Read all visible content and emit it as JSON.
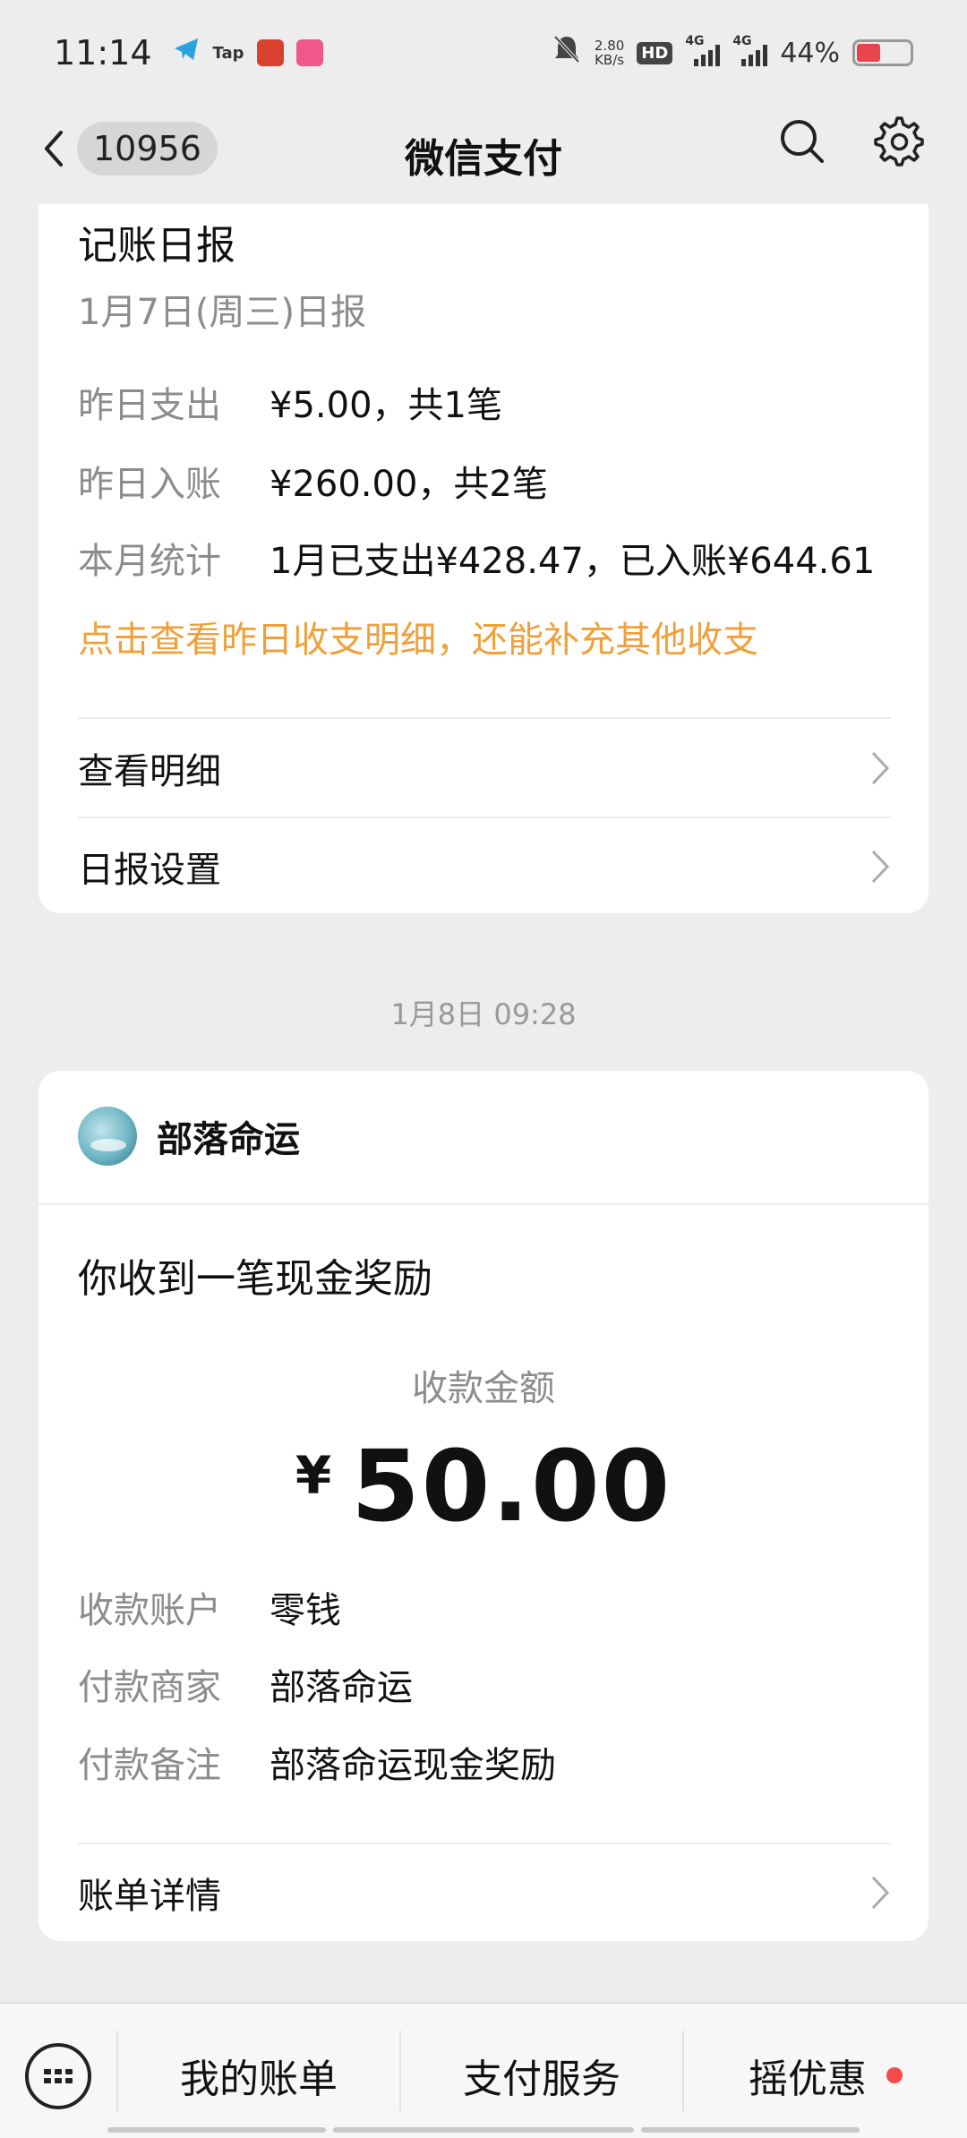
{
  "status_bar": {
    "time": "11:14",
    "app_icons": [
      "telegram-icon",
      "taptap-icon",
      "app-icon",
      "app-icon"
    ],
    "net_speed_value": "2.80",
    "net_speed_unit": "KB/s",
    "hd": "HD",
    "signal1": "4G",
    "signal2": "4G",
    "battery": "44%",
    "battery_level": 0.44
  },
  "header": {
    "unread_count": "10956",
    "title": "微信支付"
  },
  "daily_report": {
    "title": "记账日报",
    "subtitle": "1月7日(周三)日报",
    "rows": [
      {
        "key": "昨日支出",
        "value": "¥5.00，共1笔"
      },
      {
        "key": "昨日入账",
        "value": "¥260.00，共2笔"
      },
      {
        "key": "本月统计",
        "value": "1月已支出¥428.47，已入账¥644.61"
      }
    ],
    "link": "点击查看昨日收支明细，还能补充其他收支",
    "view_details": "查看明细",
    "report_settings": "日报设置"
  },
  "timestamp": "1月8日 09:28",
  "payment": {
    "merchant": "部落命运",
    "title": "你收到一笔现金奖励",
    "amount_label": "收款金额",
    "currency": "¥",
    "amount": "50.00",
    "rows": [
      {
        "key": "收款账户",
        "value": "零钱"
      },
      {
        "key": "付款商家",
        "value": "部落命运"
      },
      {
        "key": "付款备注",
        "value": "部落命运现金奖励"
      }
    ],
    "bill_details": "账单详情"
  },
  "bottom_menu": {
    "items": [
      "我的账单",
      "支付服务",
      "摇优惠"
    ]
  },
  "colors": {
    "accent_orange": "#f0a03a",
    "red_dot": "#f44b4b",
    "background": "#ededed"
  }
}
